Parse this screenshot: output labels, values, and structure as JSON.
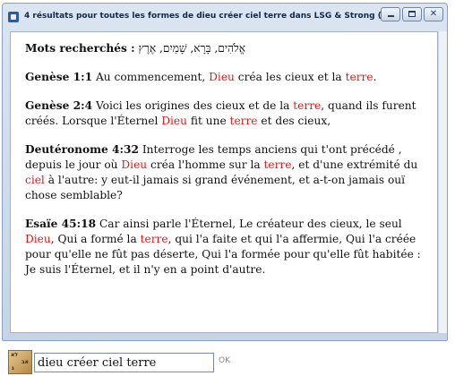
{
  "window": {
    "title": "4 résultats pour toutes les formes de dieu créer ciel terre dans LSG & Strong (AT)",
    "controls": {
      "minimize": "minimize-icon",
      "maximize": "maximize-icon",
      "close": "close-icon",
      "close_glyph": "✕"
    }
  },
  "search_terms": {
    "label": "Mots recherchés :",
    "hebrew": "אֱלֹהִים, בָּרָא, שָׁמַיִם, אֶרֶץ"
  },
  "results": [
    {
      "reference": "Genèse 1:1",
      "segments": [
        {
          "text": " Au commencement, ",
          "red": false
        },
        {
          "text": "Dieu",
          "red": true
        },
        {
          "text": " créa les cieux et la ",
          "red": false
        },
        {
          "text": "terre",
          "red": true
        },
        {
          "text": ".",
          "red": false
        }
      ]
    },
    {
      "reference": "Genèse 2:4",
      "segments": [
        {
          "text": " Voici les origines des cieux et de la ",
          "red": false
        },
        {
          "text": "terre",
          "red": true
        },
        {
          "text": ", quand ils furent créés. Lorsque l'Éternel ",
          "red": false
        },
        {
          "text": "Dieu",
          "red": true
        },
        {
          "text": " fit une ",
          "red": false
        },
        {
          "text": "terre",
          "red": true
        },
        {
          "text": " et des cieux,",
          "red": false
        }
      ]
    },
    {
      "reference": "Deutéronome 4:32",
      "segments": [
        {
          "text": " Interroge les temps anciens qui t'ont précédé , depuis le jour où ",
          "red": false
        },
        {
          "text": "Dieu",
          "red": true
        },
        {
          "text": " créa l'homme sur la ",
          "red": false
        },
        {
          "text": "terre",
          "red": true
        },
        {
          "text": ", et d'une extrémité du ",
          "red": false
        },
        {
          "text": "ciel",
          "red": true
        },
        {
          "text": " à l'autre: y eut-il jamais si grand événement, et a-t-on jamais ouï chose semblable?",
          "red": false
        }
      ]
    },
    {
      "reference": "Esaïe 45:18",
      "segments": [
        {
          "text": " Car ainsi parle l'Éternel, Le créateur des cieux, le seul ",
          "red": false
        },
        {
          "text": "Dieu",
          "red": true
        },
        {
          "text": ", Qui a formé la ",
          "red": false
        },
        {
          "text": "terre",
          "red": true
        },
        {
          "text": ", qui l'a faite et qui l'a affermie, Qui l'a créée pour qu'elle ne fût pas déserte, Qui l'a formée pour qu'elle fût habitée : Je suis l'Éternel, et il n'y en a point d'autre.",
          "red": false
        }
      ]
    }
  ],
  "bottom": {
    "icon": "strong-concordance-icon",
    "search_value": "dieu créer ciel terre",
    "ok_label": "OK"
  },
  "colors": {
    "highlight": "#d91c1c",
    "title_text": "#10284a",
    "window_frame": "#c6d4e6"
  }
}
